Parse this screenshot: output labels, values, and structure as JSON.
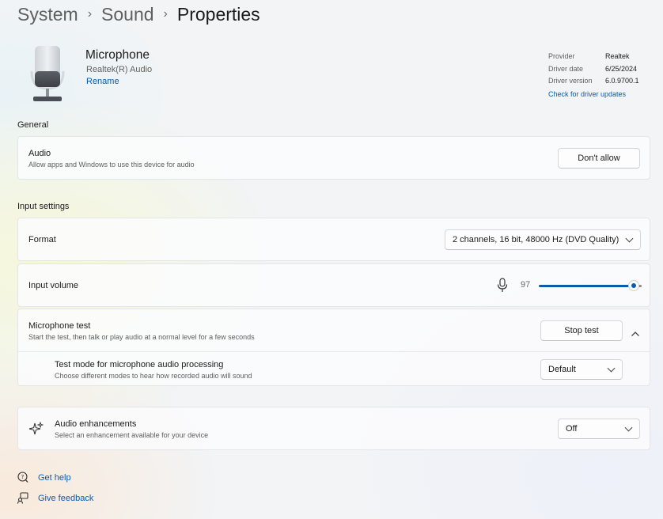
{
  "breadcrumb": [
    "System",
    "Sound",
    "Properties"
  ],
  "device": {
    "name": "Microphone",
    "subtitle": "Realtek(R) Audio",
    "rename_label": "Rename"
  },
  "driver": {
    "rows": [
      {
        "key": "Provider",
        "value": "Realtek"
      },
      {
        "key": "Driver date",
        "value": "6/25/2024"
      },
      {
        "key": "Driver version",
        "value": "6.0.9700.1"
      }
    ],
    "update_link": "Check for driver updates"
  },
  "general": {
    "heading": "General",
    "audio": {
      "title": "Audio",
      "description": "Allow apps and Windows to use this device for audio",
      "button_label": "Don't allow"
    }
  },
  "input_settings": {
    "heading": "Input settings",
    "format": {
      "title": "Format",
      "value": "2 channels, 16 bit, 48000 Hz (DVD Quality)"
    },
    "input_volume": {
      "title": "Input volume",
      "value": "97",
      "level": 0.97,
      "icon": "microphone-icon"
    },
    "microphone_test": {
      "title": "Microphone test",
      "description": "Start the test, then talk or play audio at a normal level for a few seconds",
      "button_label": "Stop test",
      "test_mode": {
        "title": "Test mode for microphone audio processing",
        "description": "Choose different modes to hear how recorded audio will sound",
        "value": "Default"
      }
    }
  },
  "enhancements": {
    "title": "Audio enhancements",
    "description": "Select an enhancement available for your device",
    "value": "Off",
    "icon": "sparkle-icon"
  },
  "footer": {
    "get_help": "Get help",
    "give_feedback": "Give feedback"
  },
  "colors": {
    "accent": "#0b5cad",
    "track": "#8a8a8a"
  }
}
